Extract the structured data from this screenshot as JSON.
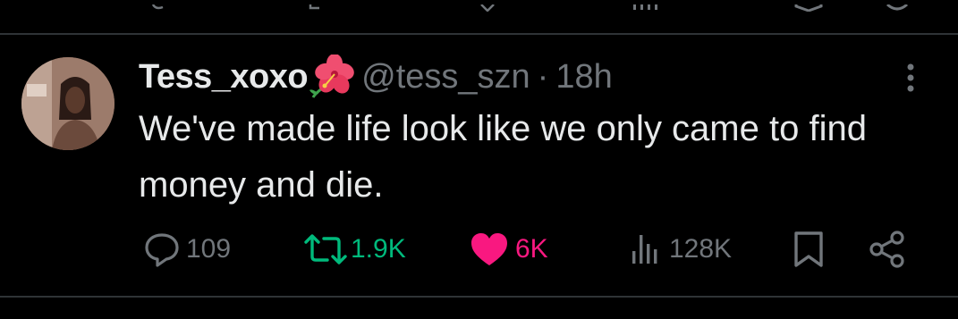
{
  "tweet": {
    "display_name": "Tess_xoxo",
    "handle": "@tess_szn",
    "separator": "·",
    "time": "18h",
    "text": "We've made life look like we only came to find money and die.",
    "icons": {
      "name_emoji": "hibiscus-icon",
      "more": "more-vertical-icon"
    }
  },
  "actions": {
    "replies": "109",
    "reposts": "1.9K",
    "likes": "6K",
    "views": "128K"
  },
  "colors": {
    "background": "#000000",
    "text_primary": "#e7e9ea",
    "text_secondary": "#71767b",
    "divider": "#2f3336",
    "repost": "#00ba7c",
    "like": "#f91880"
  }
}
